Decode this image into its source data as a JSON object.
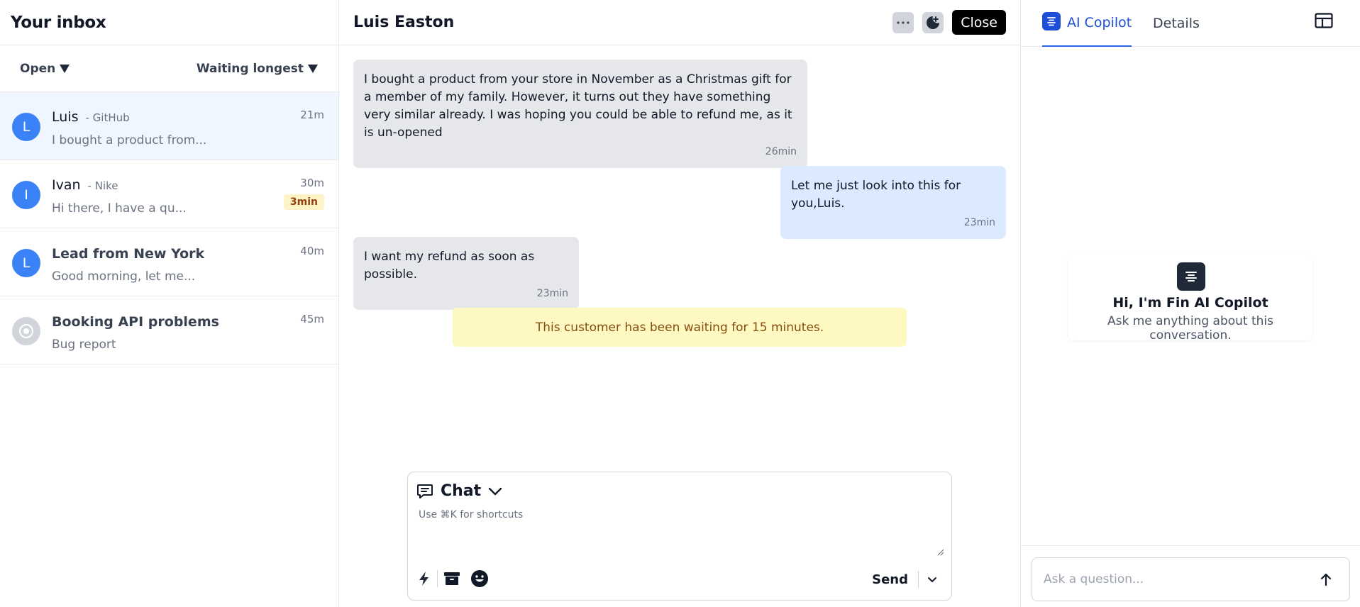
{
  "inbox": {
    "title": "Your inbox",
    "filter_status": "Open",
    "filter_sort": "Waiting longest",
    "conversations": [
      {
        "initial": "L",
        "name": "Luis",
        "company": "- GitHub",
        "preview": "I bought a product from...",
        "time": "21m"
      },
      {
        "initial": "I",
        "name": "Ivan",
        "company": "- Nike",
        "preview": "Hi there, I have a qu...",
        "time": "30m",
        "badge": "3min"
      },
      {
        "initial": "L",
        "title": "Lead from New York",
        "preview": "Good morning, let me...",
        "time": "40m"
      },
      {
        "title": "Booking API problems",
        "preview": "Bug report",
        "time": "45m"
      }
    ]
  },
  "conversation": {
    "contact_name": "Luis Easton",
    "close_label": "Close",
    "messages": [
      {
        "text": "I bought a product from your store in November as a Christmas gift for a member of my family. However, it turns out they have something very similar already. I was hoping you could be able to refund me, as it is un-opened",
        "time": "26min"
      },
      {
        "text": "Let me just look into this for you,Luis.",
        "time": "23min"
      },
      {
        "text": "I want my refund as soon as possible.",
        "time": "23min"
      }
    ],
    "notice": "This customer has been waiting for 15 minutes."
  },
  "composer": {
    "mode": "Chat",
    "placeholder": "Use ⌘K for shortcuts",
    "send_label": "Send"
  },
  "copilot": {
    "tab_active": "AI Copilot",
    "tab_details": "Details",
    "greeting": "Hi, I'm Fin AI Copilot",
    "subtitle": "Ask me anything about this conversation.",
    "ask_placeholder": "Ask a question..."
  },
  "colors": {
    "accent": "#2563eb",
    "avatar": "#3b82f6",
    "active_row": "#eff6ff",
    "incoming_bubble": "#e5e7eb",
    "outgoing_bubble": "#dbeafe",
    "notice_bg": "#fef9c3",
    "badge_bg": "#fef3c7"
  },
  "icons": [
    "menu-lines-icon",
    "more-dots-icon",
    "snooze-moon-icon",
    "chat-bubble-icon",
    "chevron-down-icon",
    "lightning-icon",
    "archive-icon",
    "emoji-icon",
    "layout-icon",
    "arrow-up-icon"
  ]
}
